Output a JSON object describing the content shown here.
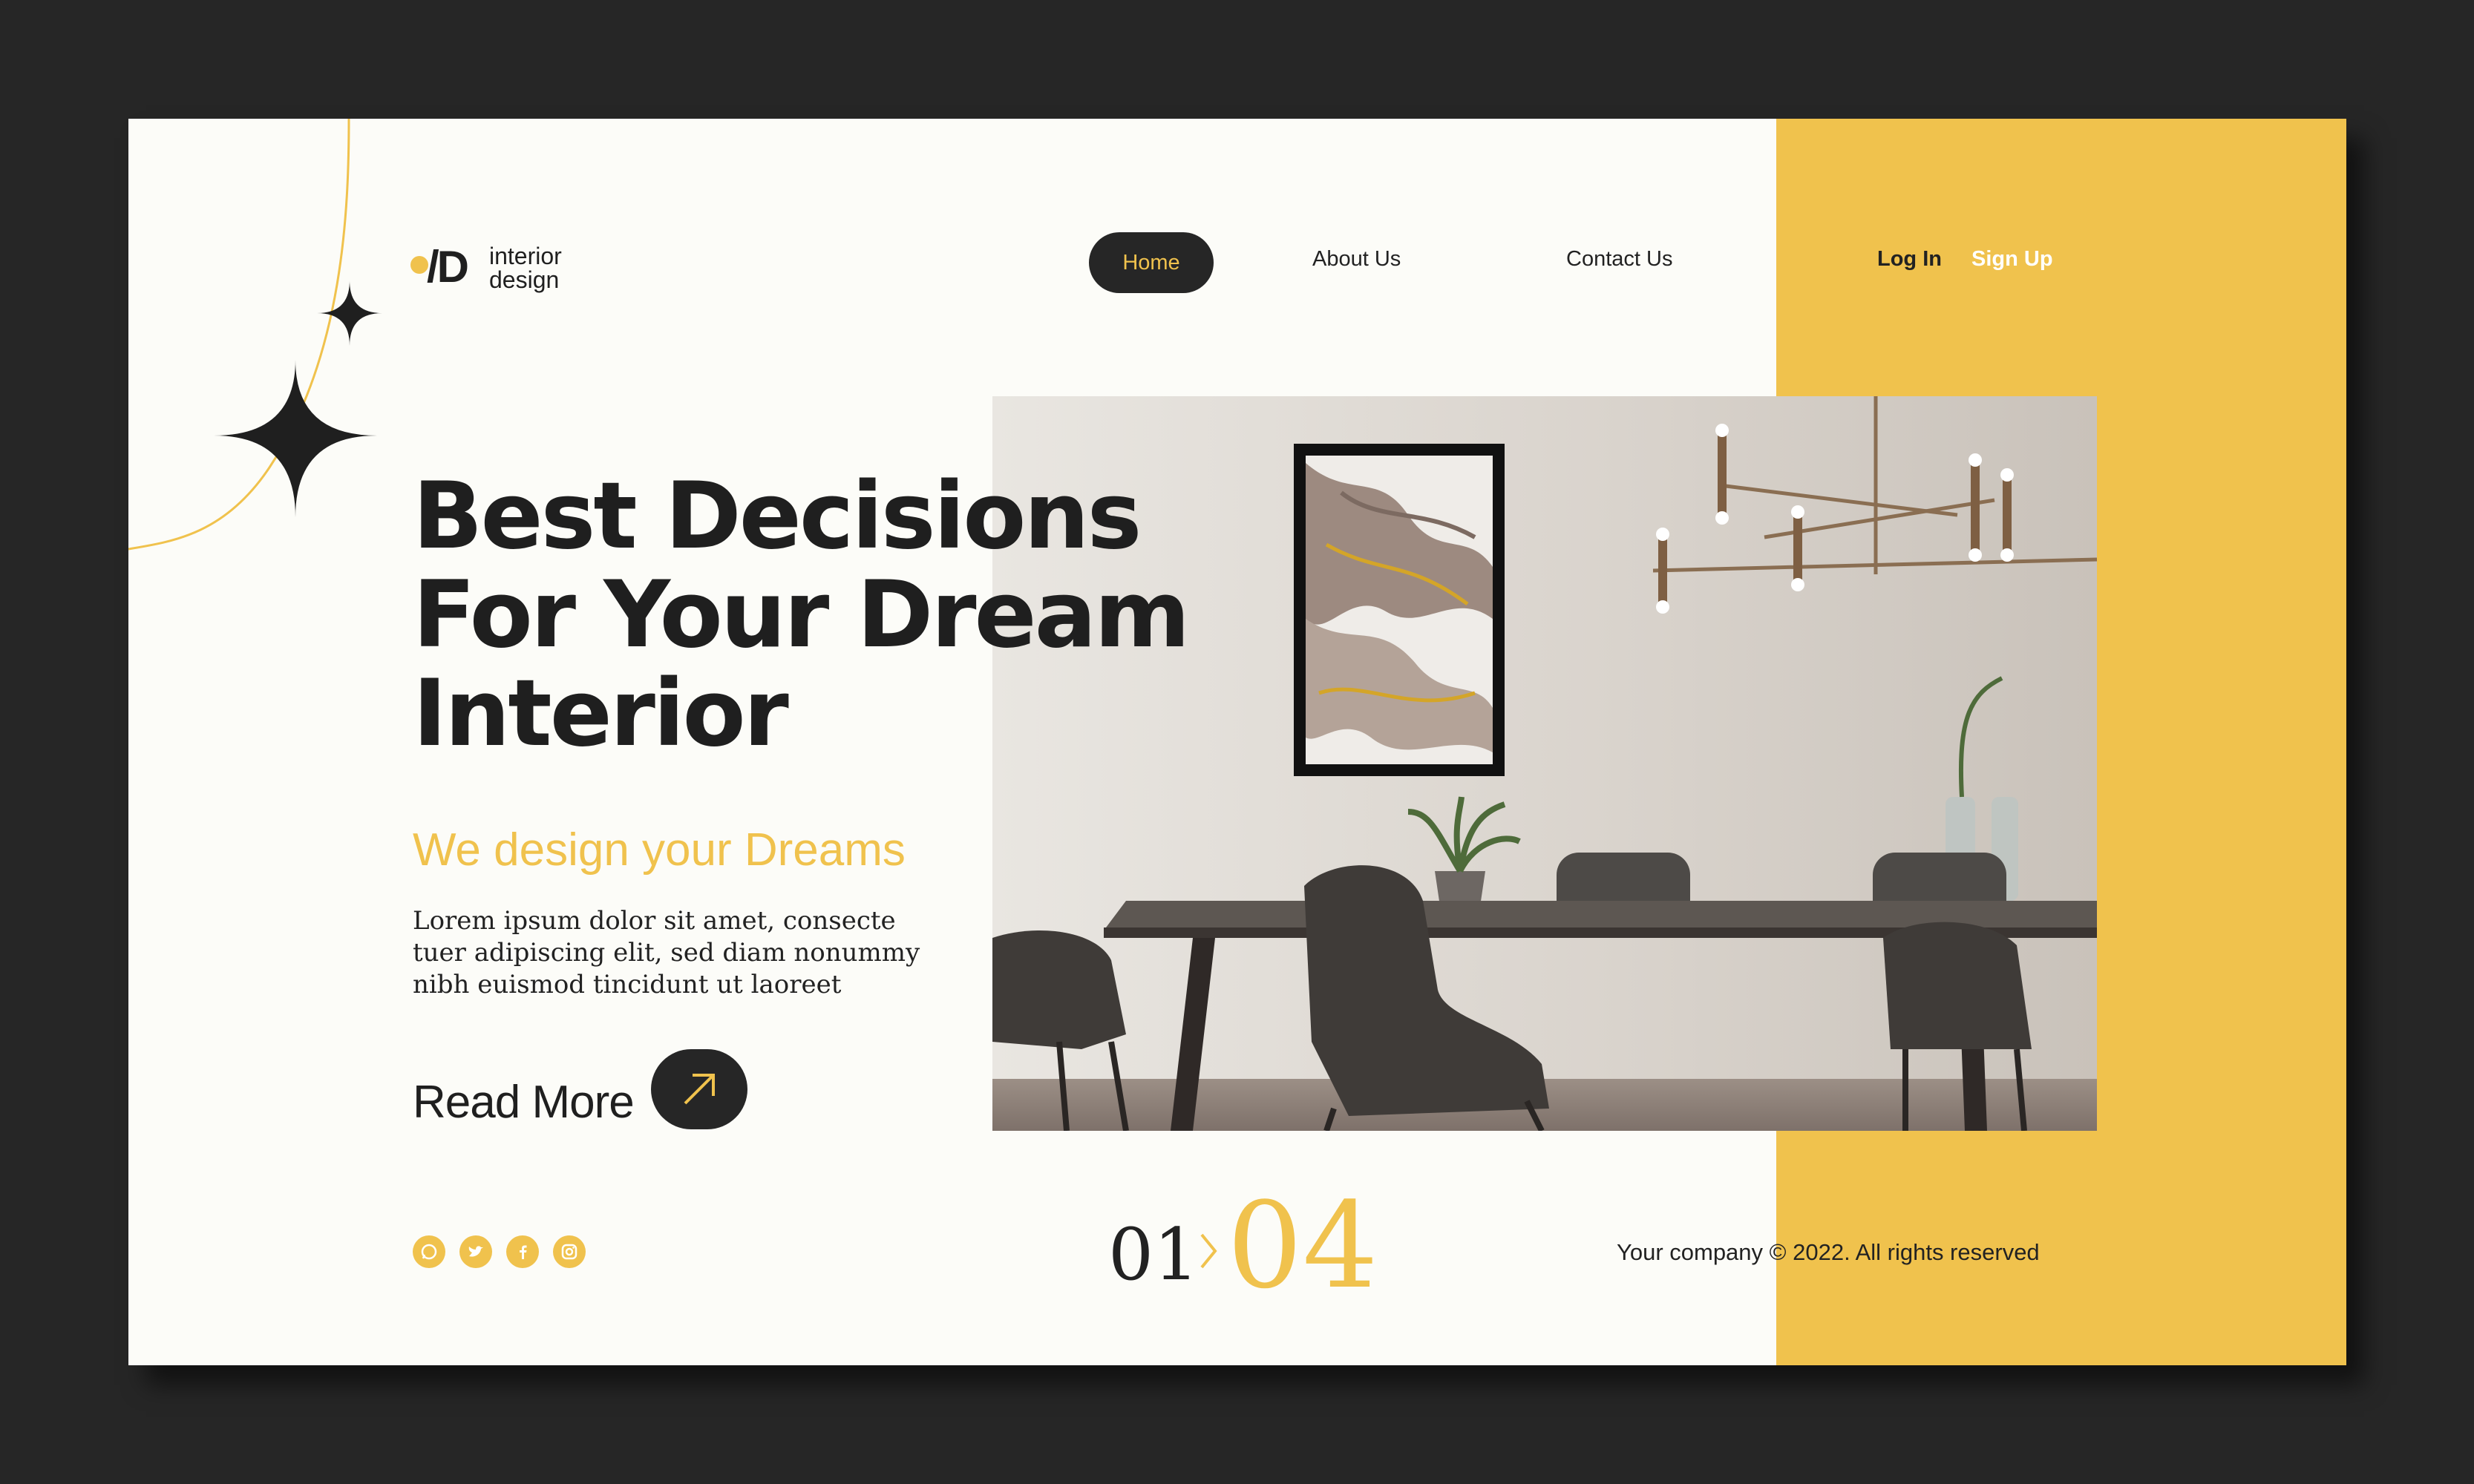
{
  "brand": {
    "mark": "/D",
    "line1": "interior",
    "line2": "design"
  },
  "nav": {
    "home": "Home",
    "about": "About Us",
    "contact": "Contact Us",
    "login": "Log In",
    "signup": "Sign Up"
  },
  "hero": {
    "title_line1": "Best Decisions",
    "title_line2": "For Your Dream",
    "title_line3": "Interior",
    "subtitle": "We design your Dreams",
    "body_line1": "Lorem ipsum dolor sit amet, consecte",
    "body_line2": "tuer adipiscing elit, sed diam nonummy",
    "body_line3": "nibh euismod tincidunt ut laoreet",
    "cta_label": "Read More",
    "cta_icon": "arrow-up-right-icon"
  },
  "social": [
    "whatsapp-icon",
    "twitter-icon",
    "facebook-icon",
    "instagram-icon"
  ],
  "pager": {
    "current": "01",
    "total": "04"
  },
  "footer": {
    "copyright": "Your company © 2022. All rights reserved"
  },
  "colors": {
    "accent": "#f0c24d",
    "dark": "#262626",
    "page": "#fcfcf8"
  }
}
